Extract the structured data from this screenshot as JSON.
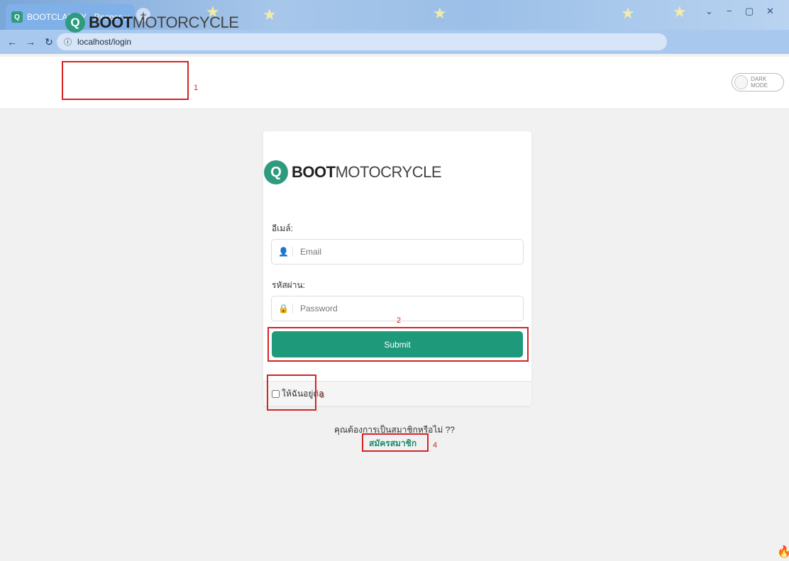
{
  "browser": {
    "tab_title": "BOOTCLASIFY - Responsive Cl",
    "tab_close": "x",
    "new_tab": "+",
    "address": "localhost/login",
    "window_controls": [
      "⌄",
      "−",
      "▢",
      "✕"
    ]
  },
  "header": {
    "logo_bold": "BOOT",
    "logo_light": "MOTORCYCLE",
    "dark_mode_label": "DARK MODE"
  },
  "card": {
    "logo_bold": "BOOT",
    "logo_light": "MOTOCRYCLE",
    "email_label": "อีเมล์:",
    "email_placeholder": "Email",
    "password_label": "รหัสผ่าน:",
    "password_placeholder": "Password",
    "submit_label": "Submit",
    "remember_label": "ให้ฉันอยู่ต่อ"
  },
  "footer": {
    "member_question": "คุณต้องการเป็นสมาชิกหรือไม่ ??",
    "register_link": "สมัครสมาชิก"
  },
  "annotations": [
    "1",
    "2",
    "3",
    "4"
  ],
  "colors": {
    "brand": "#1e9a7b",
    "annotation": "#d42424"
  }
}
